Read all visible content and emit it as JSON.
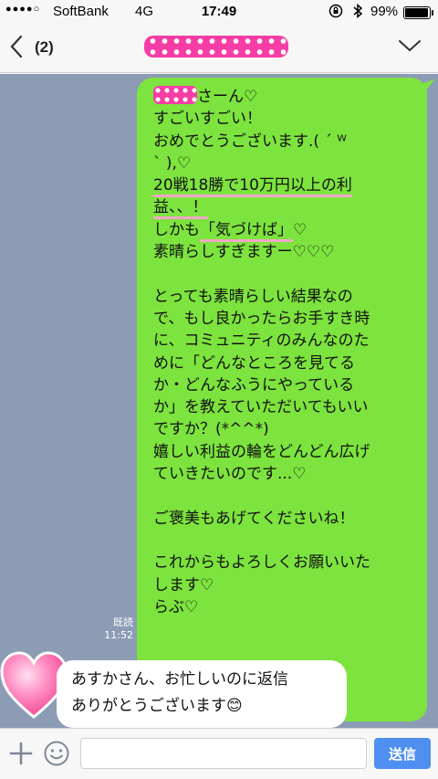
{
  "status_bar": {
    "signal": "●●●●○",
    "carrier": "SoftBank",
    "network": "4G",
    "time": "17:49",
    "battery": "99%",
    "battery_level": 0.99
  },
  "header": {
    "back_count": "(2)"
  },
  "messages": {
    "outgoing": {
      "greeting_suffix": "さーん♡",
      "lines": [
        "すごいすごい！",
        "おめでとうございます.( ´ ᵂ",
        "` ),♡"
      ],
      "highlight_1a": "20戦18勝で10万円以上の利",
      "highlight_1b": "益、、！",
      "line_shikamo_pre": "しかも",
      "highlight_2": "「気づけば」",
      "line_shikamo_post": "♡",
      "line_subarashi": "素晴らしすぎますー♡♡♡",
      "paragraph_2": [
        "とっても素晴らしい結果なの",
        "で、もし良かったらお手すき時",
        "に、コミュニティのみんなのた",
        "めに「どんなところを見てる",
        "か・どんなふうにやっている",
        "か」を教えていただいてもいい",
        "ですか？(*^^*)",
        "嬉しい利益の輪をどんどん広げ",
        "ていきたいのです...♡"
      ],
      "paragraph_3": "ご褒美もあげてくださいね！",
      "paragraph_4": [
        "これからもよろしくお願いいた",
        "します♡",
        "らぶ♡"
      ],
      "read_label": "既読",
      "time": "11:52"
    },
    "incoming": {
      "line_1": "あすかさん、お忙しいのに返信",
      "line_2": "ありがとうございます😊"
    }
  },
  "input_bar": {
    "placeholder": "",
    "send_label": "送信"
  }
}
